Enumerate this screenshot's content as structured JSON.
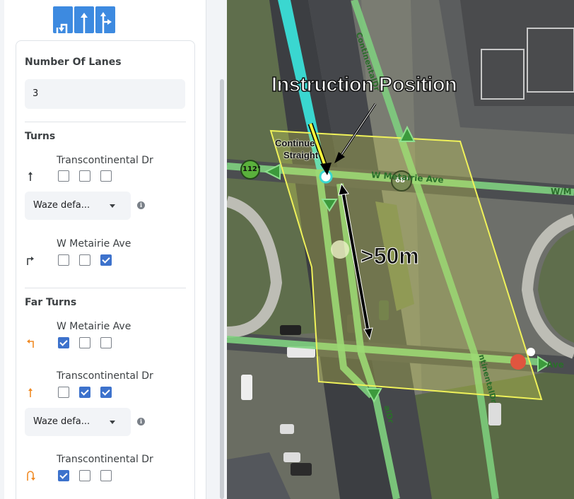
{
  "lane_guidance": {
    "arrows": [
      "uturn-left-arrow",
      "straight-arrow",
      "straight-right-arrow"
    ],
    "color": "#3d8ae0"
  },
  "panel": {
    "number_of_lanes_label": "Number Of Lanes",
    "number_of_lanes_value": "3",
    "turns_label": "Turns",
    "far_turns_label": "Far Turns",
    "turns": [
      {
        "segment": "Transcontinental Dr",
        "icon": "straight-arrow-icon",
        "lanes": [
          false,
          false,
          false
        ],
        "has_select": true,
        "select_value": "Waze defa..."
      },
      {
        "segment": "W Metairie Ave",
        "icon": "right-turn-icon",
        "lanes": [
          false,
          false,
          true
        ],
        "has_select": false
      }
    ],
    "far_turns": [
      {
        "segment": "W Metairie Ave",
        "icon": "left-turn-icon",
        "lanes": [
          true,
          false,
          false
        ],
        "has_select": false
      },
      {
        "segment": "Transcontinental Dr",
        "icon": "straight-arrow-icon",
        "lanes": [
          false,
          true,
          true
        ],
        "has_select": true,
        "select_value": "Waze defa..."
      },
      {
        "segment": "Transcontinental Dr",
        "icon": "u-turn-icon",
        "lanes": [
          true,
          false,
          false
        ],
        "has_select": false
      }
    ],
    "checkbox_color": "#3d72cc",
    "far_turn_icon_color": "#f08a24"
  },
  "map": {
    "annotation_title": "Instruction Position",
    "distance_label": ">50m",
    "continue_label_line1": "Continue",
    "continue_label_line2": "Straight",
    "angle_left": "112°",
    "angle_right": "68°",
    "street_top": "ContinentalDr",
    "street_w_metairie": "W Metairie Ave",
    "street_w_m_right": "W/M",
    "street_bottom": "ntinentalDr",
    "street_bottom2": "alDr",
    "street_ave": "Ave",
    "road_color": "#7fd27f",
    "junction_box_color": "#e6ee55"
  }
}
